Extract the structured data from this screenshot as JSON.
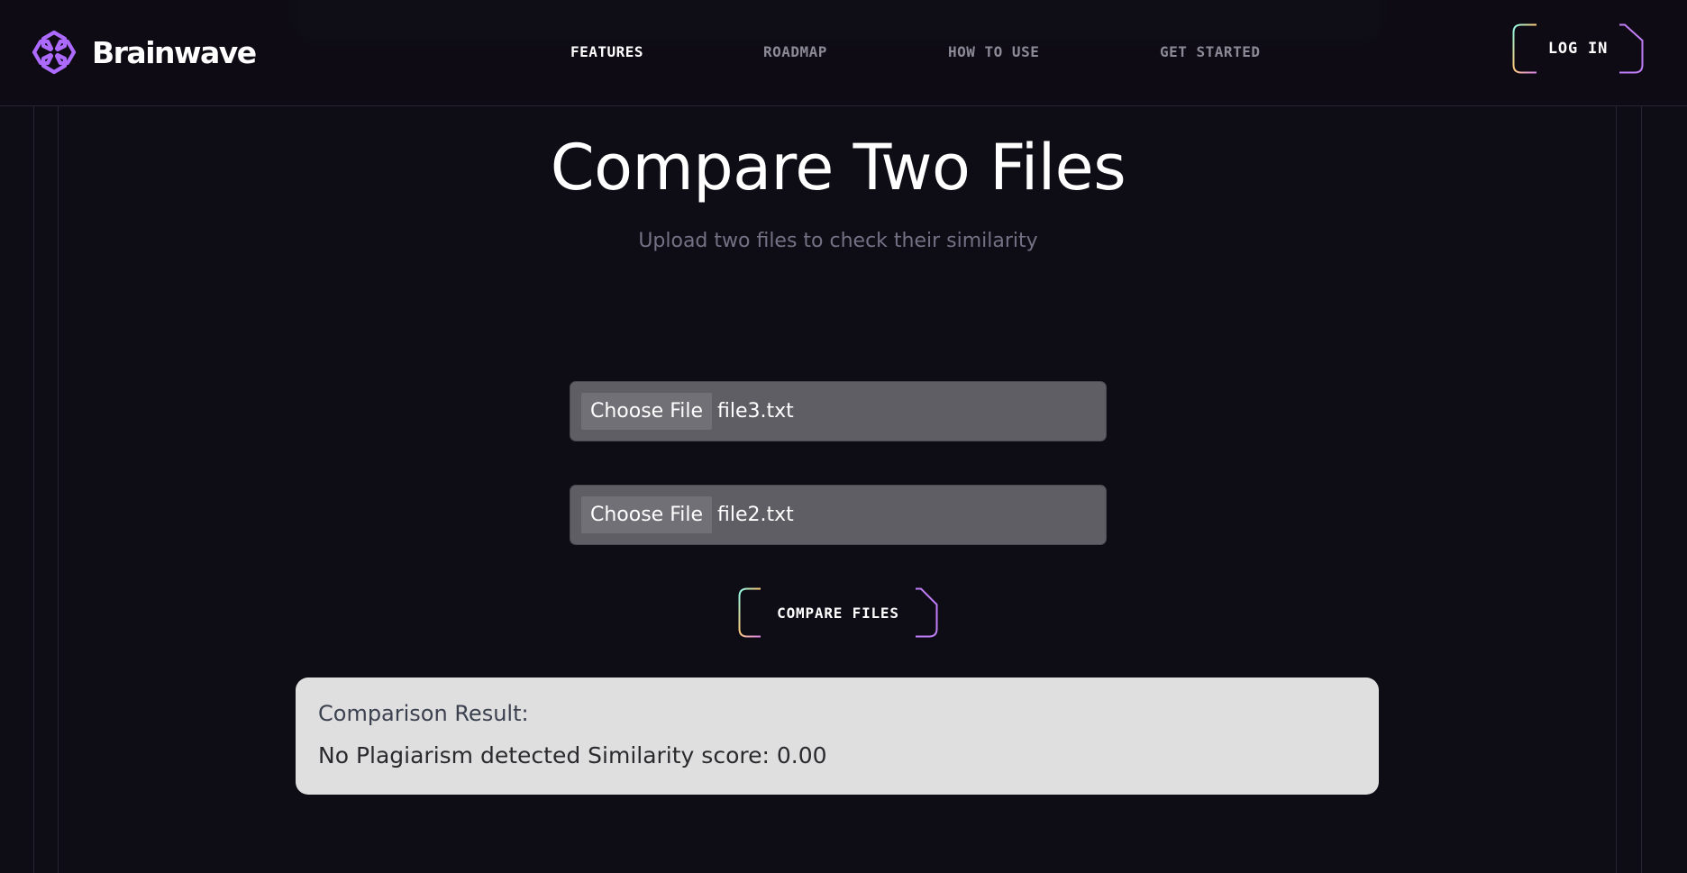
{
  "brand": {
    "name": "Brainwave",
    "logo_icon": "brainwave-logo-icon",
    "logo_color": "#ac6aff"
  },
  "nav": {
    "items": [
      {
        "label": "FEATURES",
        "active": true
      },
      {
        "label": "ROADMAP",
        "active": false
      },
      {
        "label": "HOW TO USE",
        "active": false
      },
      {
        "label": "GET STARTED",
        "active": false
      }
    ],
    "login_label": "LOG IN"
  },
  "main": {
    "title": "Compare Two Files",
    "subtitle": "Upload two files to check their similarity",
    "file_inputs": [
      {
        "button_label": "Choose File",
        "file_name": "file3.txt"
      },
      {
        "button_label": "Choose File",
        "file_name": "file2.txt"
      }
    ],
    "compare_label": "COMPARE FILES"
  },
  "result": {
    "heading": "Comparison Result:",
    "text": "No Plagiarism detected Similarity score: 0.00"
  },
  "colors": {
    "background": "#0e0c15",
    "border_line": "#26242f",
    "nav_inactive": "#8b8a96",
    "subtitle": "#757185",
    "file_input_bg": "#5f5e65",
    "result_bg": "#dfdfdf",
    "gradient_teal": "#89f9e8",
    "gradient_yellow": "#facb7b",
    "gradient_purple": "#d87cee",
    "gradient_violet": "#9099fc"
  }
}
